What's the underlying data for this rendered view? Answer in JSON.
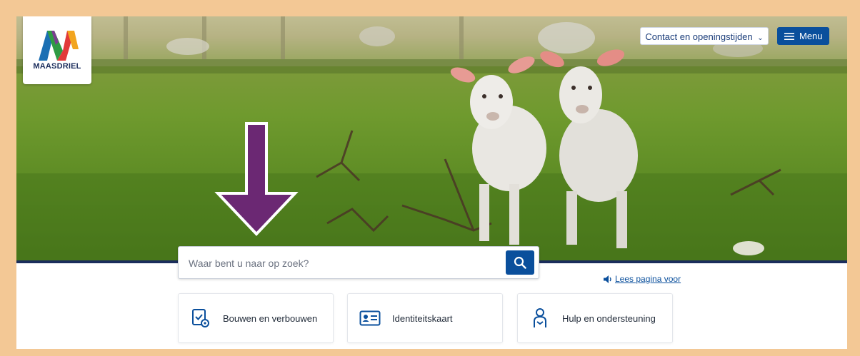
{
  "header": {
    "logo_text": "MAASDRIEL",
    "contact_label": "Contact en openingstijden",
    "menu_label": "Menu"
  },
  "search": {
    "placeholder": "Waar bent u naar op zoek?"
  },
  "read_aloud": {
    "label": "Lees pagina voor"
  },
  "cards": [
    {
      "label": "Bouwen en verbouwen",
      "icon": "building-permit-icon"
    },
    {
      "label": "Identiteitskaart",
      "icon": "id-card-icon"
    },
    {
      "label": "Hulp en ondersteuning",
      "icon": "person-support-icon"
    }
  ],
  "colors": {
    "primary": "#0a4f9c",
    "navy": "#1b2d5c",
    "frame": "#f3c895",
    "arrow": "#6b2873"
  }
}
